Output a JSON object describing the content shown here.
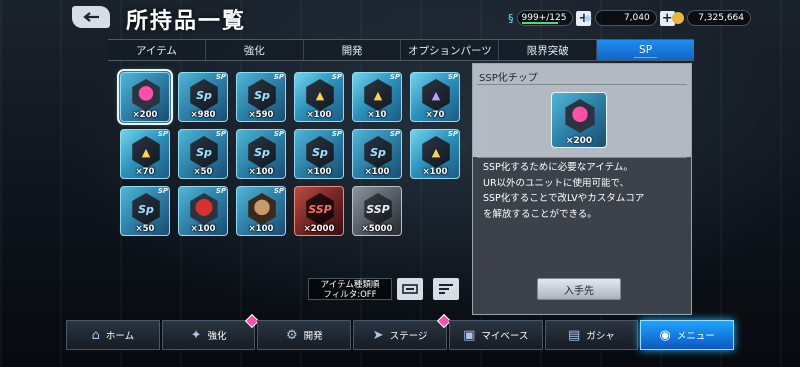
{
  "header": {
    "title": "所持品一覧",
    "stamina": "999+/125",
    "gems": "7,040",
    "coins": "7,325,664"
  },
  "tabs": [
    {
      "label": "アイテム",
      "active": false
    },
    {
      "label": "強化",
      "active": false
    },
    {
      "label": "開発",
      "active": false
    },
    {
      "label": "オプションパーツ",
      "active": false
    },
    {
      "label": "限界突破",
      "active": false
    },
    {
      "label": "SP",
      "active": true
    }
  ],
  "items": [
    {
      "qty": "×200",
      "kind": "chip-pink",
      "selected": true
    },
    {
      "qty": "×980",
      "kind": "sp-blue"
    },
    {
      "qty": "×590",
      "kind": "sp-blue"
    },
    {
      "qty": "×100",
      "kind": "sp-label"
    },
    {
      "qty": "×10",
      "kind": "sp-label"
    },
    {
      "qty": "×70",
      "kind": "sp-label"
    },
    {
      "qty": "×70",
      "kind": "sp-label"
    },
    {
      "qty": "×50",
      "kind": "sp-blue"
    },
    {
      "qty": "×100",
      "kind": "sp-blue"
    },
    {
      "qty": "×100",
      "kind": "sp-blue"
    },
    {
      "qty": "×100",
      "kind": "sp-blue"
    },
    {
      "qty": "×100",
      "kind": "sp-label"
    },
    {
      "qty": "×50",
      "kind": "sp-blue"
    },
    {
      "qty": "×100",
      "kind": "red-mech"
    },
    {
      "qty": "×100",
      "kind": "portrait"
    },
    {
      "qty": "×2000",
      "kind": "ssp-red"
    },
    {
      "qty": "×5000",
      "kind": "ssp-gray"
    }
  ],
  "sort": {
    "label_line1": "アイテム種類順",
    "label_line2": "フィルタ:OFF"
  },
  "detail": {
    "title": "SSP化チップ",
    "qty": "×200",
    "description_lines": [
      "SSP化するために必要なアイテム。",
      "UR以外のユニットに使用可能で、",
      "SSP化することで改LVやカスタムコア",
      "を解放することができる。"
    ],
    "source_button": "入手先"
  },
  "nav": [
    {
      "label": "ホーム",
      "icon": "home-icon",
      "badge": false
    },
    {
      "label": "強化",
      "icon": "upgrade-icon",
      "badge": true
    },
    {
      "label": "開発",
      "icon": "develop-icon",
      "badge": false
    },
    {
      "label": "ステージ",
      "icon": "stage-icon",
      "badge": true
    },
    {
      "label": "マイベース",
      "icon": "base-icon",
      "badge": false
    },
    {
      "label": "ガシャ",
      "icon": "gacha-icon",
      "badge": false
    },
    {
      "label": "メニュー",
      "icon": "menu-icon",
      "badge": false,
      "active": true
    }
  ],
  "colors": {
    "accent": "#1f8df0",
    "badge": "#ff4fa8",
    "stamina_bar": "#3de07a"
  }
}
